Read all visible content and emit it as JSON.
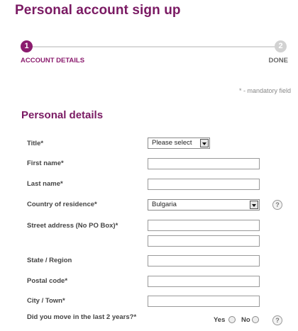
{
  "page": {
    "title": "Personal account sign up"
  },
  "progress": {
    "steps": [
      {
        "number": "1",
        "label": "ACCOUNT DETAILS",
        "active": true
      },
      {
        "number": "2",
        "label": "DONE",
        "active": false
      }
    ]
  },
  "mandatory_note": "* - mandatory field",
  "section": {
    "title": "Personal details"
  },
  "form": {
    "title_label": "Title*",
    "title_select": {
      "value": "Please select"
    },
    "first_name_label": "First name*",
    "last_name_label": "Last name*",
    "country_label": "Country of residence*",
    "country_select": {
      "value": "Bulgaria"
    },
    "street_label": "Street address (No PO Box)*",
    "state_label": "State / Region",
    "postal_label": "Postal code*",
    "city_label": "City / Town*",
    "moved_label": "Did you move in the last 2 years?*",
    "yes_label": "Yes",
    "no_label": "No",
    "help_glyph": "?"
  },
  "icons": {
    "help": "help-icon",
    "dropdown": "chevron-down-icon"
  },
  "colors": {
    "brand": "#7a1a63",
    "active_step": "#8b1c6e",
    "inactive_step": "#d2d2d2"
  }
}
